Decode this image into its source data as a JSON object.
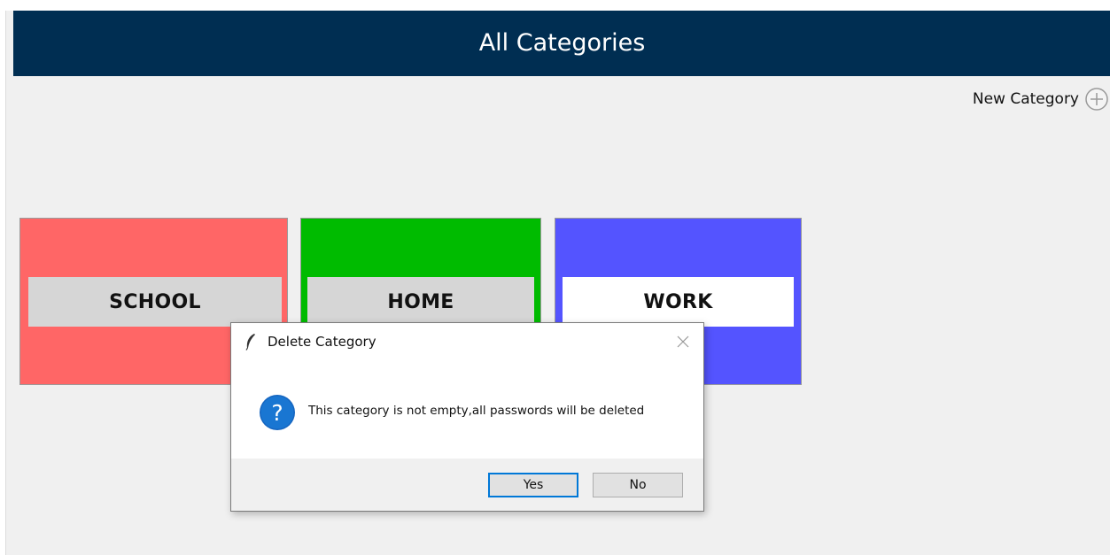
{
  "header": {
    "title": "All Categories"
  },
  "toolbar": {
    "new_category_label": "New Category",
    "new_category_icon": "plus-circle-icon"
  },
  "categories": [
    {
      "label": "SCHOOL",
      "color": "#ff6666"
    },
    {
      "label": "HOME",
      "color": "#00bb00"
    },
    {
      "label": "WORK",
      "color": "#5454ff"
    }
  ],
  "dialog": {
    "title": "Delete Category",
    "message": "This category is not empty,all passwords will be deleted",
    "icon": "question-icon",
    "buttons": {
      "yes": "Yes",
      "no": "No"
    }
  },
  "colors": {
    "header_bg": "#002e52",
    "accent": "#0078d7"
  }
}
